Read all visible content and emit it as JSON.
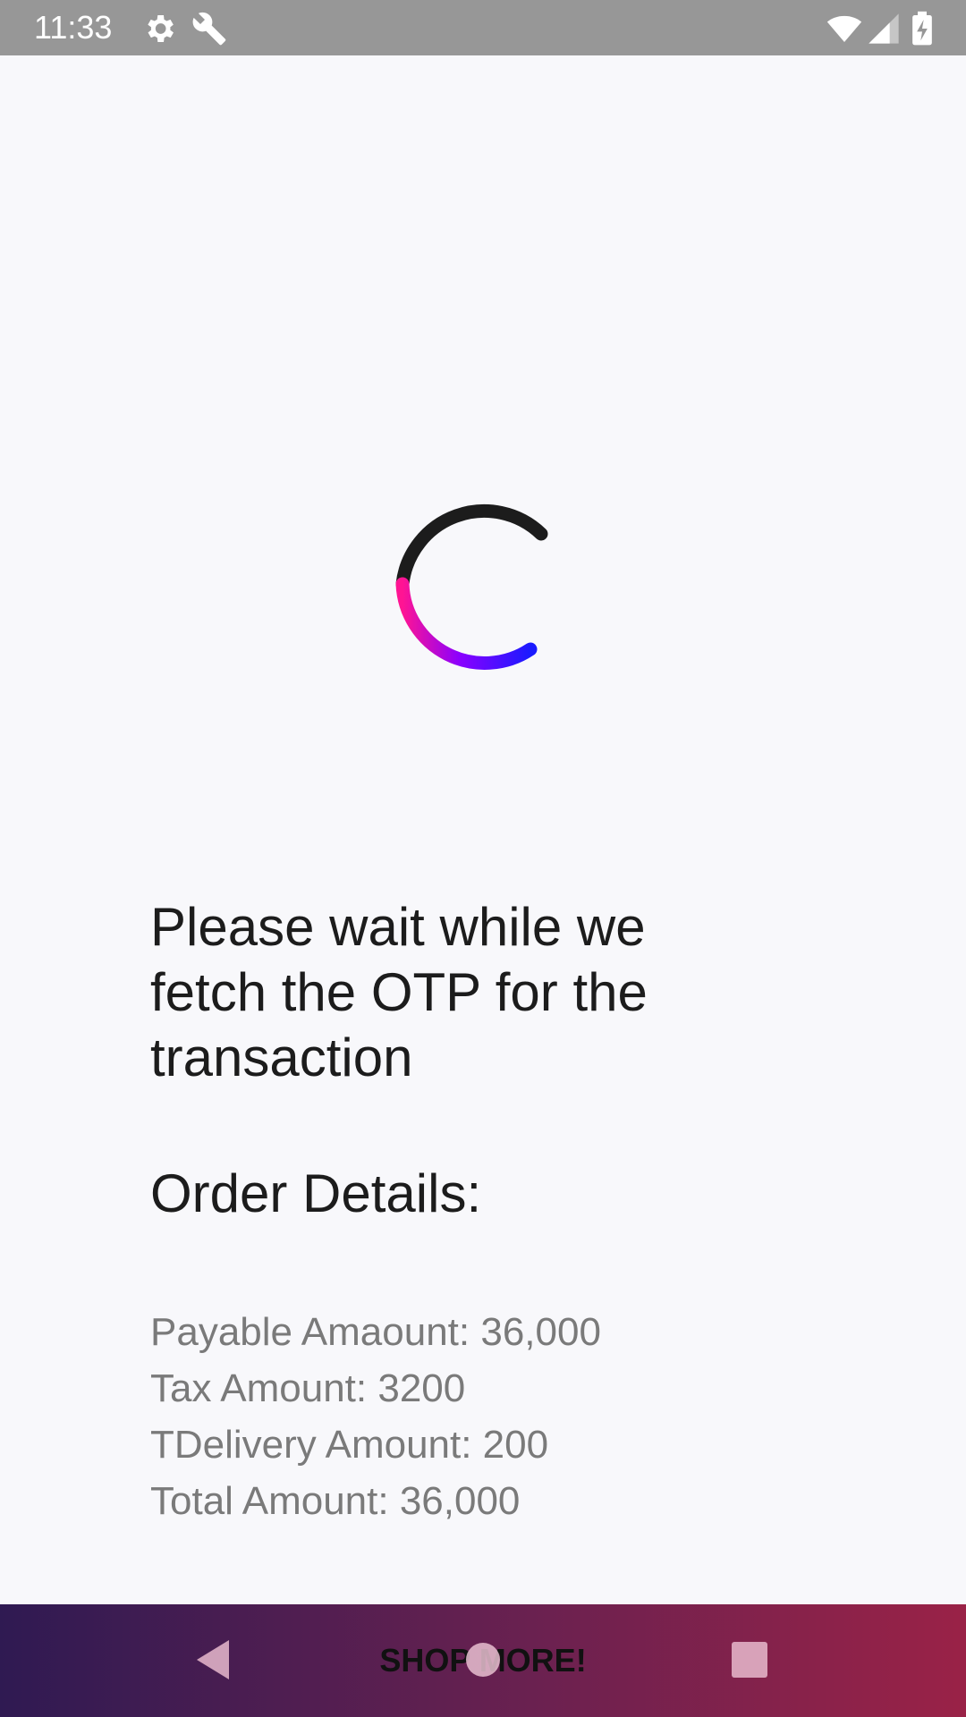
{
  "status_bar": {
    "time": "11:33",
    "icons": [
      "settings-icon",
      "wrench-icon",
      "wifi-icon",
      "signal-icon",
      "battery-charging-icon"
    ]
  },
  "loading": {
    "message": "Please wait while we\nfetch the OTP for the\ntransaction",
    "spinner_colors": [
      "#1c1c1c",
      "#ff1493",
      "#8a00ff",
      "#1a1aff"
    ]
  },
  "order": {
    "title": "Order Details:",
    "lines": [
      "Payable Amaount: 36,000",
      "Tax Amount: 3200",
      "TDelivery Amount: 200",
      "Total Amount: 36,000"
    ]
  },
  "bottom": {
    "button_label": "SHOP MORE!",
    "nav": [
      "back-icon",
      "home-icon",
      "recents-icon"
    ],
    "gradient": [
      "#2f1a52",
      "#9a2247"
    ]
  }
}
